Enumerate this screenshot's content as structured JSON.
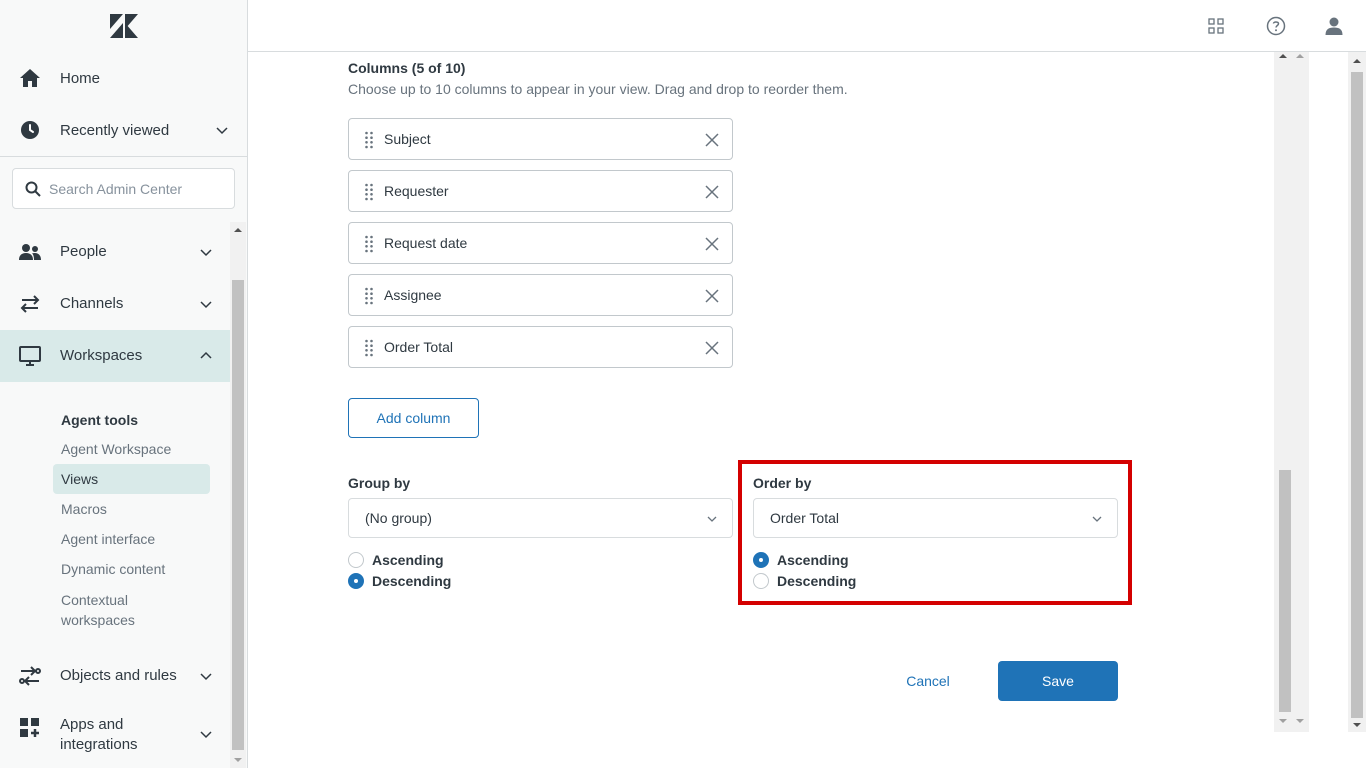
{
  "sidebar": {
    "home": "Home",
    "recently_viewed": "Recently viewed",
    "search_placeholder": "Search Admin Center",
    "people": "People",
    "channels": "Channels",
    "workspaces": "Workspaces",
    "agent_tools_heading": "Agent tools",
    "sub_items": [
      "Agent Workspace",
      "Views",
      "Macros",
      "Agent interface",
      "Dynamic content",
      "Contextual workspaces"
    ],
    "objects_and_rules": "Objects and rules",
    "apps_and_integrations_1": "Apps and",
    "apps_and_integrations_2": "integrations"
  },
  "header": {
    "icons": [
      "products-grid-icon",
      "help-icon",
      "user-icon"
    ]
  },
  "columns": {
    "title": "Columns (5 of 10)",
    "hint": "Choose up to 10 columns to appear in your view. Drag and drop to reorder them.",
    "items": [
      "Subject",
      "Requester",
      "Request date",
      "Assignee",
      "Order Total"
    ],
    "add_label": "Add column"
  },
  "group_by": {
    "label": "Group by",
    "value": "(No group)",
    "ascending": "Ascending",
    "descending": "Descending",
    "selected": "Descending"
  },
  "order_by": {
    "label": "Order by",
    "value": "Order Total",
    "ascending": "Ascending",
    "descending": "Descending",
    "selected": "Ascending"
  },
  "actions": {
    "cancel": "Cancel",
    "save": "Save"
  },
  "colors": {
    "accent": "#1f73b7",
    "active_bg": "#d9eae9",
    "highlight": "#d40000"
  }
}
